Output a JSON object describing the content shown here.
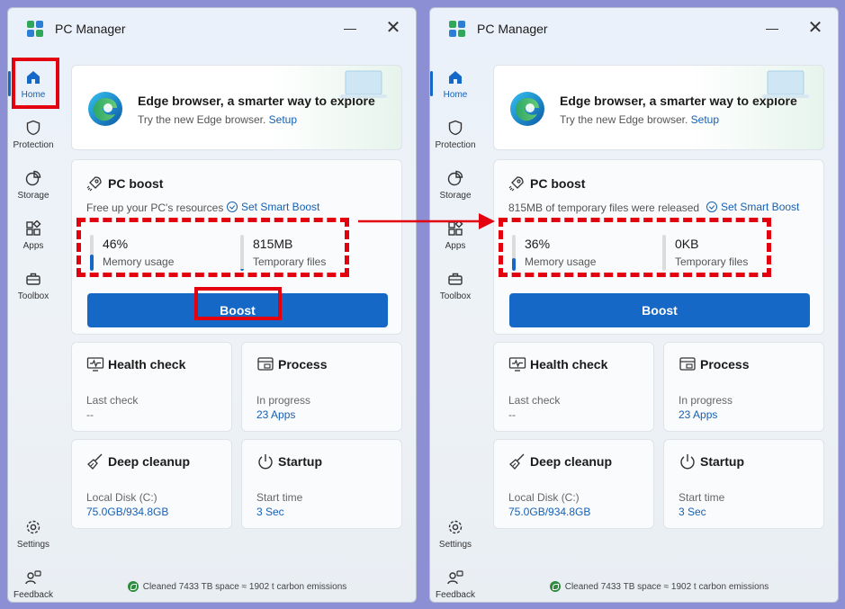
{
  "app": {
    "title": "PC Manager"
  },
  "nav": {
    "home": "Home",
    "protection": "Protection",
    "storage": "Storage",
    "apps": "Apps",
    "toolbox": "Toolbox",
    "settings": "Settings",
    "feedback": "Feedback"
  },
  "edge": {
    "title": "Edge browser, a smarter way to explore",
    "subtitle": "Try the new Edge browser.",
    "setup_link": "Setup"
  },
  "boost_title": "PC boost",
  "smart_boost_label": "Set Smart Boost",
  "boost_button": "Boost",
  "before": {
    "desc": "Free up your PC's resources",
    "memory_value": "46%",
    "memory_fill": 0.46,
    "memory_label": "Memory usage",
    "temp_value": "815MB",
    "temp_fill": 0.06,
    "temp_label": "Temporary files"
  },
  "after": {
    "desc": "815MB of temporary files were released",
    "memory_value": "36%",
    "memory_fill": 0.36,
    "memory_label": "Memory usage",
    "temp_value": "0KB",
    "temp_fill": 0.0,
    "temp_label": "Temporary files"
  },
  "tiles": {
    "health": {
      "title": "Health check",
      "label": "Last check",
      "value": "--"
    },
    "process": {
      "title": "Process",
      "label": "In progress",
      "value": "23 Apps"
    },
    "cleanup": {
      "title": "Deep cleanup",
      "label": "Local Disk (C:)",
      "value": "75.0GB/934.8GB"
    },
    "startup": {
      "title": "Startup",
      "label": "Start time",
      "value": "3 Sec"
    }
  },
  "footer": "Cleaned 7433 TB space ≈ 1902 t carbon emissions",
  "colors": {
    "accent": "#1568c6",
    "highlight": "#e3000f",
    "background": "#8c8fd4"
  }
}
